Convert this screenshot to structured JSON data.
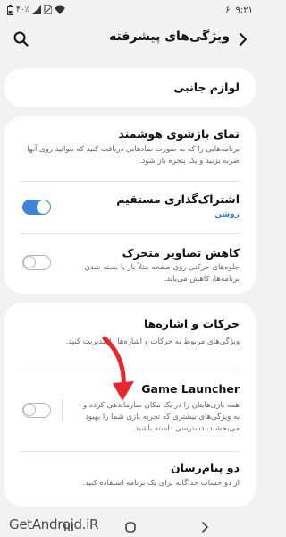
{
  "status_bar": {
    "time": "۹:۲۱",
    "notification_count": "۶",
    "battery": "۴۰٪"
  },
  "header": {
    "title": "ویژگی‌های پیشرفته"
  },
  "accessories": {
    "label": "لوازم جانبی"
  },
  "smart_popup": {
    "title": "نمای بازشوی هوشمند",
    "subtitle": "برنامه‌هایی را که به صورت نمادهایی دریافت کنید که بتوانید روی آنها ضربه بزنید و یک پنجره باز شود."
  },
  "direct_share": {
    "title": "اشتراک‌گذاری مستقیم",
    "status": "روشن",
    "enabled": true
  },
  "reduce_animations": {
    "title": "کاهش تصاویر متحرک",
    "subtitle": "جلوه‌های حرکتی روی صفحه مثلاً باز یا بسته شدن برنامه‌ها، کاهش می‌یابد.",
    "enabled": false
  },
  "motions_gestures": {
    "title": "حرکات و اشاره‌ها",
    "subtitle": "ویژگی‌های مربوط به حرکات و اشاره‌ها را مدیریت کنید."
  },
  "game_launcher": {
    "title": "Game Launcher",
    "subtitle": "همه بازی‌هایتان را در یک مکان سازماندهی کرده و به ویژگی‌های بیشتری که تجربه بازی شما را بهبود می‌بخشند، دسترسی داشته باشید.",
    "enabled": false
  },
  "dual_messenger": {
    "title": "دو پیام‌رسان",
    "subtitle": "از دو حساب جداگانه برای یک برنامه استفاده کنید."
  },
  "watermark": {
    "text": "GetAndroid.iR"
  },
  "colors": {
    "accent": "#3e85d9",
    "arrow": "#e8252b"
  },
  "icons": [
    "search-icon",
    "back-arrow-icon",
    "recents-icon",
    "home-icon",
    "nav-back-icon"
  ]
}
